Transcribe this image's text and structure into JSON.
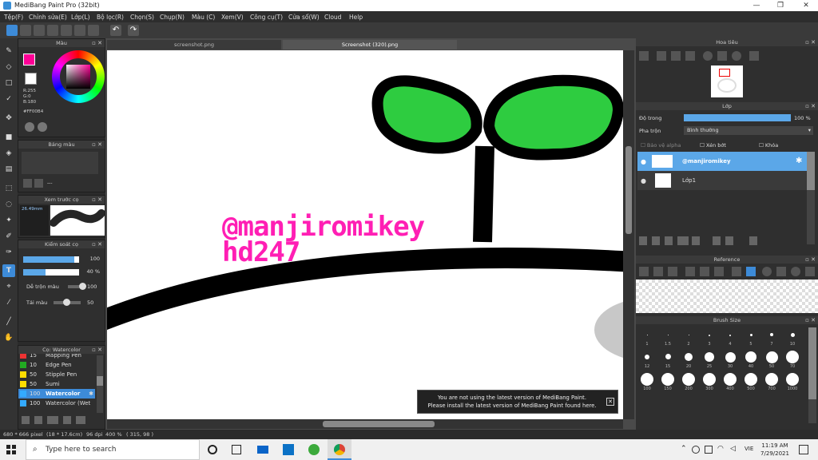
{
  "window": {
    "title": "MediBang Paint Pro (32bit)",
    "min": "—",
    "max": "❐",
    "close": "✕"
  },
  "menu": [
    "Tệp(F)",
    "Chỉnh sửa(E)",
    "Lớp(L)",
    "Bộ lọc(R)",
    "Chọn(S)",
    "Chụp(N)",
    "Màu (C)",
    "Xem(V)",
    "Công cụ(T)",
    "Cửa sổ(W)",
    "Cloud",
    "Help"
  ],
  "tabs": [
    "screenshot.png",
    "Screenshot (320).png"
  ],
  "color_panel": {
    "title": "Màu",
    "values": [
      "R:255",
      "G:0",
      "B:180"
    ],
    "hex": "#FF00B4",
    "primary": "#ff0096",
    "secondary": "#ffffff"
  },
  "palette_panel": {
    "title": "Bảng màu",
    "extra": "---"
  },
  "preview_panel": {
    "title": "Xem trước cọ",
    "size": "26.49mm"
  },
  "brush_control": {
    "title": "Kiểm soát cọ",
    "size_val": "100",
    "opacity_val": "40 %",
    "mix_label": "Dễ trộn màu",
    "mix_val": "100",
    "amount_label": "Tải màu",
    "amount_val": "50"
  },
  "brush_list": {
    "title": "Cọ: Watercolor",
    "items": [
      {
        "size": "15",
        "name": "Mapping Pen",
        "color": "#e33"
      },
      {
        "size": "10",
        "name": "Edge Pen",
        "color": "#2a2"
      },
      {
        "size": "50",
        "name": "Stipple Pen",
        "color": "#fd0"
      },
      {
        "size": "50",
        "name": "Sumi",
        "color": "#fd0"
      },
      {
        "size": "100",
        "name": "Watercolor",
        "color": "#3af"
      },
      {
        "size": "100",
        "name": "Watercolor (Wet",
        "color": "#3af"
      }
    ]
  },
  "canvas": {
    "text1": "@manjiromikey",
    "text2": "hd247"
  },
  "notification": {
    "line1": "You are not using the latest version of MediBang Paint.",
    "line2": "Please install the latest version of MediBang Paint found here.",
    "close": "✕"
  },
  "navigator": {
    "title": "Hoa tiêu"
  },
  "layer_panel": {
    "title": "Lớp",
    "opacity_label": "Độ trong",
    "opacity_val": "100 %",
    "blend_label": "Pha trộn",
    "blend_val": "Bình thường",
    "protect_alpha": "Bảo vệ alpha",
    "clipping": "Xén bớt",
    "lock": "Khóa",
    "layers": [
      {
        "name": "@manjiromikey",
        "selected": true
      },
      {
        "name": "Lớp1",
        "selected": false
      }
    ]
  },
  "reference": {
    "title": "Reference"
  },
  "brush_size": {
    "title": "Brush Size",
    "rows": [
      [
        "1",
        "1.5",
        "2",
        "3",
        "4",
        "5",
        "7",
        "10"
      ],
      [
        "12",
        "15",
        "20",
        "25",
        "30",
        "40",
        "50",
        "70"
      ],
      [
        "100",
        "150",
        "200",
        "300",
        "400",
        "500",
        "700",
        "1000"
      ]
    ]
  },
  "status": {
    "dims": "680 * 666 pixel",
    "cm": "(18 * 17.6cm)",
    "dpi": "96 dpi",
    "zoom": "400 %",
    "coords": "( 315, 98 )"
  },
  "taskbar": {
    "search": "Type here to search",
    "time": "11:19 AM",
    "date": "7/29/2021",
    "lang": "VIE"
  }
}
